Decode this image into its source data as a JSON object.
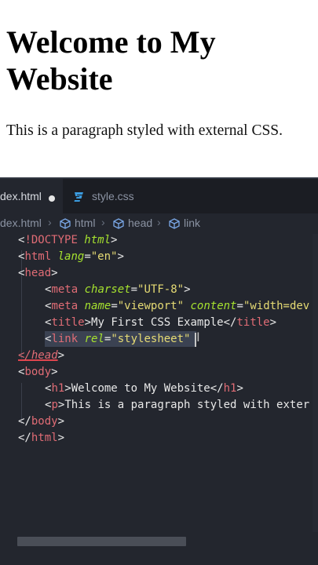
{
  "preview": {
    "heading": "Welcome to My Website",
    "paragraph": "This is a paragraph styled with external CSS."
  },
  "tabs": [
    {
      "label": "dex.html",
      "icon": "modified-dot-icon"
    },
    {
      "label": "style.css",
      "icon": "css-file-icon"
    }
  ],
  "breadcrumb": [
    "dex.html",
    "html",
    "head",
    "link"
  ],
  "code_lines": [
    "<!DOCTYPE html>",
    "<html lang=\"en\">",
    "<head>",
    "<meta charset=\"UTF-8\">",
    "<meta name=\"viewport\" content=\"width=dev",
    "<title>My First CSS Example</title>",
    "<link rel=\"stylesheet\"",
    "</head>",
    "<body>",
    "<h1>Welcome to My Website</h1>",
    "<p>This is a paragraph styled with exter",
    "</body>",
    "</html>"
  ],
  "colors": {
    "editor_bg": "#23262e",
    "tag": "#e06c75",
    "attribute": "#a6e22e",
    "string": "#e6db74",
    "css_icon": "#3b9cdf"
  }
}
